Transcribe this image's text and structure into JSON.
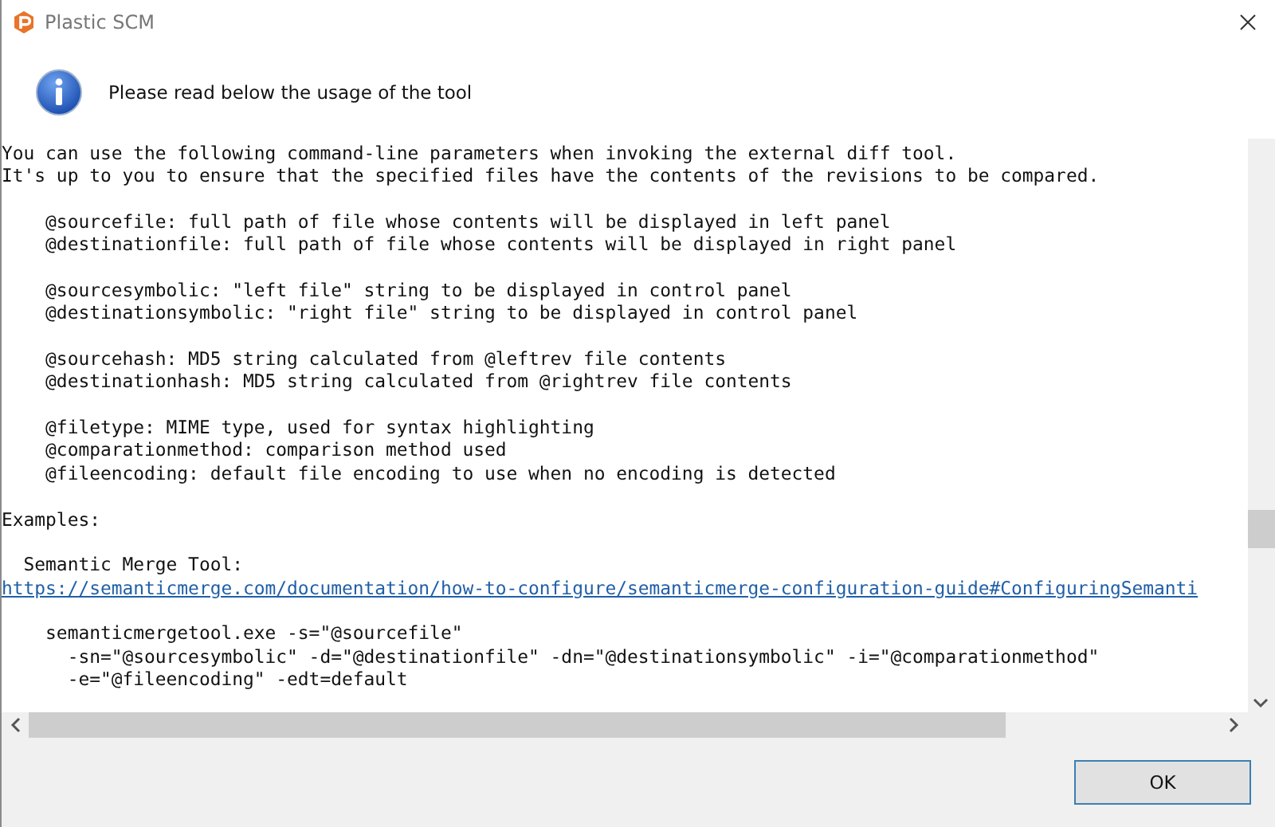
{
  "window": {
    "title": "Plastic SCM"
  },
  "message": "Please read below the usage of the tool",
  "content": [
    [
      {
        "kind": "text",
        "text": "You can use the following command-line parameters when invoking the external diff tool."
      },
      {
        "kind": "text",
        "text": "It's up to you to ensure that the specified files have the contents of the revisions to be compared."
      }
    ],
    [
      {
        "kind": "text",
        "text": "    @sourcefile: full path of file whose contents will be displayed in left panel"
      },
      {
        "kind": "text",
        "text": "    @destinationfile: full path of file whose contents will be displayed in right panel"
      }
    ],
    [
      {
        "kind": "text",
        "text": "    @sourcesymbolic: \"left file\" string to be displayed in control panel"
      },
      {
        "kind": "text",
        "text": "    @destinationsymbolic: \"right file\" string to be displayed in control panel"
      }
    ],
    [
      {
        "kind": "text",
        "text": "    @sourcehash: MD5 string calculated from @leftrev file contents"
      },
      {
        "kind": "text",
        "text": "    @destinationhash: MD5 string calculated from @rightrev file contents"
      }
    ],
    [
      {
        "kind": "text",
        "text": "    @filetype: MIME type, used for syntax highlighting"
      },
      {
        "kind": "text",
        "text": "    @comparationmethod: comparison method used"
      },
      {
        "kind": "text",
        "text": "    @fileencoding: default file encoding to use when no encoding is detected"
      }
    ],
    [
      {
        "kind": "text",
        "text": "Examples:"
      }
    ],
    [
      {
        "kind": "text",
        "text": "  Semantic Merge Tool:"
      },
      {
        "kind": "link",
        "text": "https://semanticmerge.com/documentation/how-to-configure/semanticmerge-configuration-guide#ConfiguringSemanti"
      }
    ],
    [
      {
        "kind": "text",
        "text": "    semanticmergetool.exe -s=\"@sourcefile\""
      },
      {
        "kind": "text",
        "text": "      -sn=\"@sourcesymbolic\" -d=\"@destinationfile\" -dn=\"@destinationsymbolic\" -i=\"@comparationmethod\""
      },
      {
        "kind": "text",
        "text": "      -e=\"@fileencoding\" -edt=default"
      }
    ]
  ],
  "buttons": [
    "OK"
  ]
}
